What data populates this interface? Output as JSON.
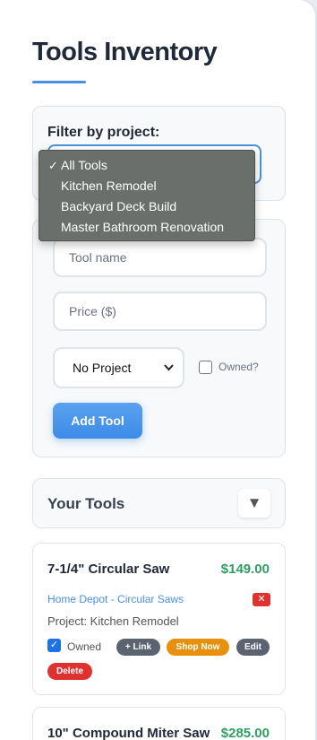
{
  "page": {
    "title": "Tools Inventory"
  },
  "filter": {
    "label": "Filter by project:",
    "options": [
      "All Tools",
      "Kitchen Remodel",
      "Backyard Deck Build",
      "Master Bathroom Renovation"
    ],
    "selected_mark": "✓"
  },
  "form": {
    "name_placeholder": "Tool name",
    "price_placeholder": "Price ($)",
    "project_value": "No Project",
    "owned_label": "Owned?",
    "add_label": "Add Tool"
  },
  "tools_section": {
    "title": "Your Tools",
    "toggle_icon": "▼"
  },
  "tools": [
    {
      "name": "7-1/4\" Circular Saw",
      "price": "$149.00",
      "link": "Home Depot - Circular Saws",
      "remove_link_icon": "✕",
      "project": "Project: Kitchen Remodel",
      "owned": true,
      "owned_label": "Owned",
      "link_btn": "+ Link",
      "shop_btn": "Shop Now",
      "edit_btn": "Edit",
      "delete_btn": "Delete"
    },
    {
      "name": "10\" Compound Miter Saw",
      "price": "$285.00"
    }
  ],
  "colors": {
    "accent": "#4a90e2",
    "price_green": "#2f9e62",
    "danger": "#e03131",
    "shop": "#e8900c",
    "neutral_pill": "#5b6270"
  },
  "icons": {
    "check": "✓",
    "chevron": "chevron-down-icon"
  }
}
